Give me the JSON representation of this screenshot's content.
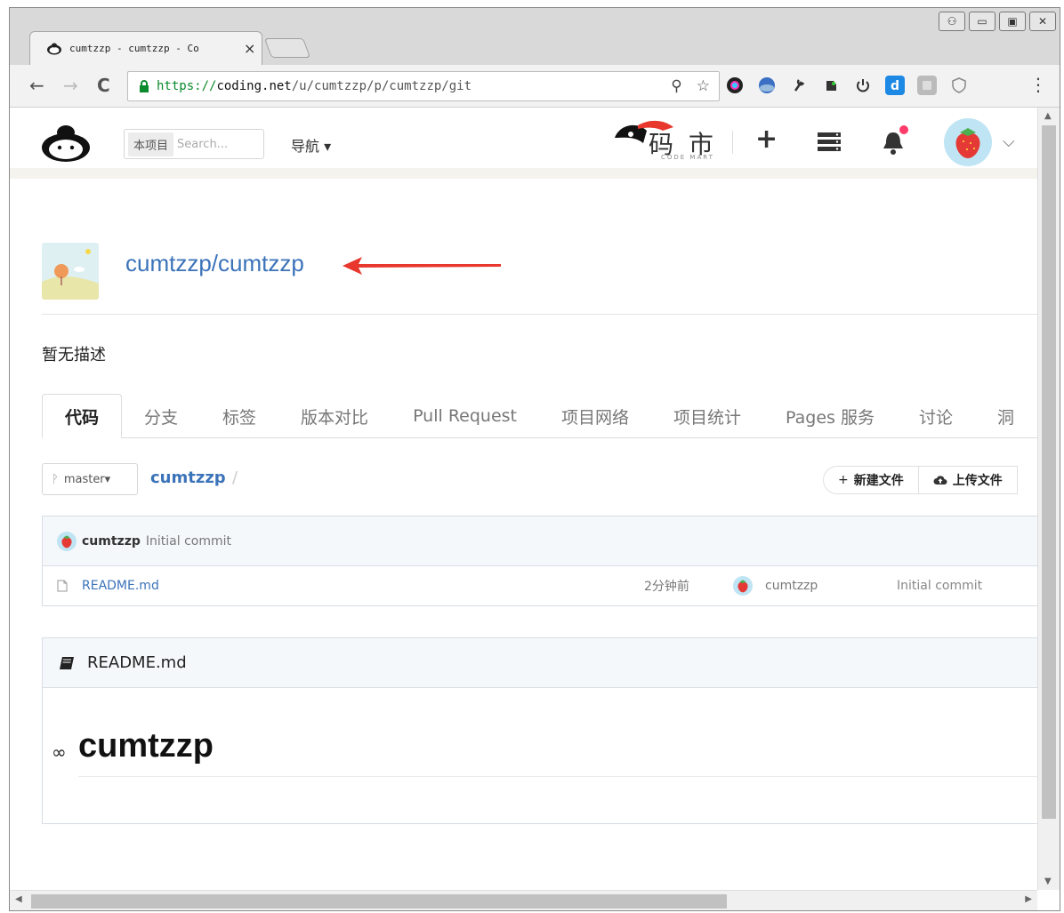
{
  "browser": {
    "tab_title": "cumtzzp - cumtzzp - Co",
    "tab_close": "×",
    "url_scheme": "https://",
    "url_host": "coding.net",
    "url_path": "/u/cumtzzp/p/cumtzzp/git",
    "back": "←",
    "forward": "→",
    "reload": "C",
    "key_icon": "⚲",
    "star": "☆",
    "menu": "⋮",
    "window_controls": {
      "user": "⚇",
      "minimize": "▭",
      "maximize": "▣",
      "close": "✕"
    }
  },
  "header": {
    "search_scope": "本项目",
    "search_placeholder": "Search...",
    "nav_label": "导航 ▾",
    "market_text": "码 市",
    "market_sub": "CODE MART",
    "plus": "+",
    "chevron": "⌵"
  },
  "project": {
    "name": "cumtzzp/cumtzzp",
    "description": "暂无描述"
  },
  "tabs": [
    {
      "label": "代码",
      "active": true
    },
    {
      "label": "分支"
    },
    {
      "label": "标签"
    },
    {
      "label": "版本对比"
    },
    {
      "label": "Pull Request"
    },
    {
      "label": "项目网络"
    },
    {
      "label": "项目统计"
    },
    {
      "label": "Pages 服务"
    },
    {
      "label": "讨论"
    },
    {
      "label": "洞"
    }
  ],
  "repo": {
    "branch": "master▾",
    "branch_icon": "ᚹ",
    "breadcrumb": "cumtzzp",
    "breadcrumb_sep": "/",
    "new_file": "新建文件",
    "upload_file": "上传文件"
  },
  "last_commit": {
    "author": "cumtzzp",
    "message": "Initial commit"
  },
  "files": [
    {
      "name": "README.md",
      "time": "2分钟前",
      "user": "cumtzzp",
      "message": "Initial commit"
    }
  ],
  "readme": {
    "title": "README.md",
    "heading": "cumtzzp"
  },
  "colors": {
    "link": "#3b73b9",
    "arrow": "#e8382e",
    "avatar_bg": "#bfe4f4"
  }
}
